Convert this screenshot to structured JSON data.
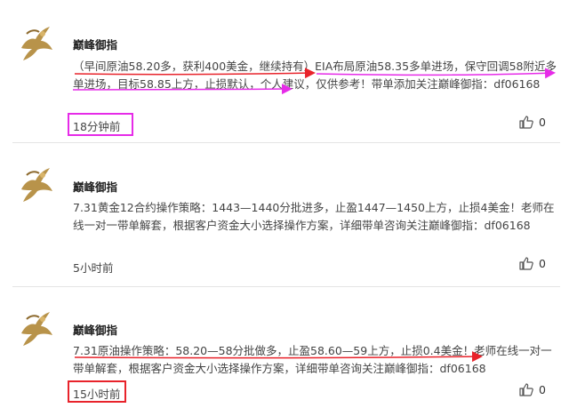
{
  "posts": [
    {
      "username": "巅峰御指",
      "content": "（早间原油58.20多，获利400美金，继续持有）EIA布局原油58.35多单进场，保守回调58附近多单进场，目标58.85上方，止损默认，个人建议，仅供参考！带单添加关注巅峰御指：df06168",
      "time": "18分钟前",
      "likes": "0"
    },
    {
      "username": "巅峰御指",
      "content": "7.31黄金12合约操作策略：1443—1440分批进多，止盈1447—1450上方，止损4美金！老师在线一对一带单解套，根据客户资金大小选择操作方案，详细带单咨询关注巅峰御指：df06168",
      "time": "5小时前",
      "likes": "0"
    },
    {
      "username": "巅峰御指",
      "content": "7.31原油操作策略：58.20—58分批做多，止盈58.60—59上方，止损0.4美金！老师在线一对一带单解套，根据客户资金大小选择操作方案，详细带单咨询关注巅峰御指：df06168",
      "time": "15小时前",
      "likes": "0"
    }
  ],
  "colors": {
    "annotation_magenta": "#e62be8",
    "annotation_red": "#e8232b",
    "avatar_gold": "#b8934a"
  },
  "icons": {
    "like": "thumbs-up-icon",
    "avatar": "golden-hand-logo"
  }
}
